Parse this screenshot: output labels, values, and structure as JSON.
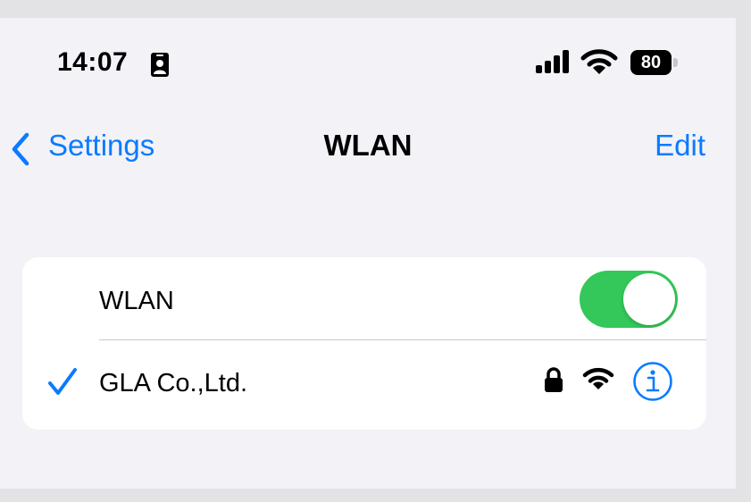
{
  "status_bar": {
    "time": "14:07",
    "battery_level": "80",
    "icons": [
      "id-card-icon",
      "cellular-signal-icon",
      "wifi-icon",
      "battery-icon"
    ]
  },
  "nav": {
    "back_label": "Settings",
    "title": "WLAN",
    "edit_label": "Edit"
  },
  "wlan_section": {
    "toggle_label": "WLAN",
    "toggle_on": true,
    "connected_network": {
      "name": "GLA Co.,Ltd.",
      "icons": [
        "checkmark-icon",
        "lock-icon",
        "wifi-icon",
        "info-icon"
      ]
    }
  },
  "colors": {
    "accent": "#0a7bff",
    "toggle_on": "#34c759",
    "background": "#f2f2f7"
  }
}
